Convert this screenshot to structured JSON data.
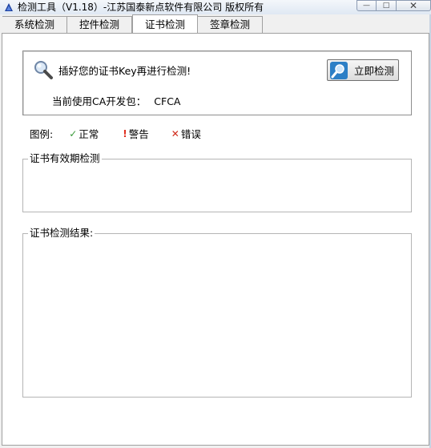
{
  "window": {
    "title": "检测工具（V1.18）-江苏国泰新点软件有限公司 版权所有",
    "min_glyph": "—",
    "max_glyph": "□",
    "close_glyph": "✕"
  },
  "tabs": [
    {
      "label": "系统检测",
      "active": false
    },
    {
      "label": "控件检测",
      "active": false
    },
    {
      "label": "证书检测",
      "active": true
    },
    {
      "label": "签章检测",
      "active": false
    }
  ],
  "cert_panel": {
    "insert_message": "插好您的证书Key再进行检测!",
    "detect_button_label": "立即检测",
    "ca_label": "当前使用CA开发包：",
    "ca_value": "CFCA"
  },
  "legend": {
    "label": "图例:",
    "items": [
      {
        "glyph": "✓",
        "label": "正常",
        "icon": "check-icon",
        "color": "#3a9a3a"
      },
      {
        "glyph": "!",
        "label": "警告",
        "icon": "warning-icon",
        "color": "#e03020"
      },
      {
        "glyph": "✕",
        "label": "错误",
        "icon": "error-icon",
        "color": "#d02a1a"
      }
    ]
  },
  "groups": {
    "validity_caption": "证书有效期检测",
    "result_caption": "证书检测结果:"
  },
  "icons": {
    "app": "app-triangle-icon",
    "search": "magnifier-icon",
    "detect": "magnifier-button-icon"
  }
}
